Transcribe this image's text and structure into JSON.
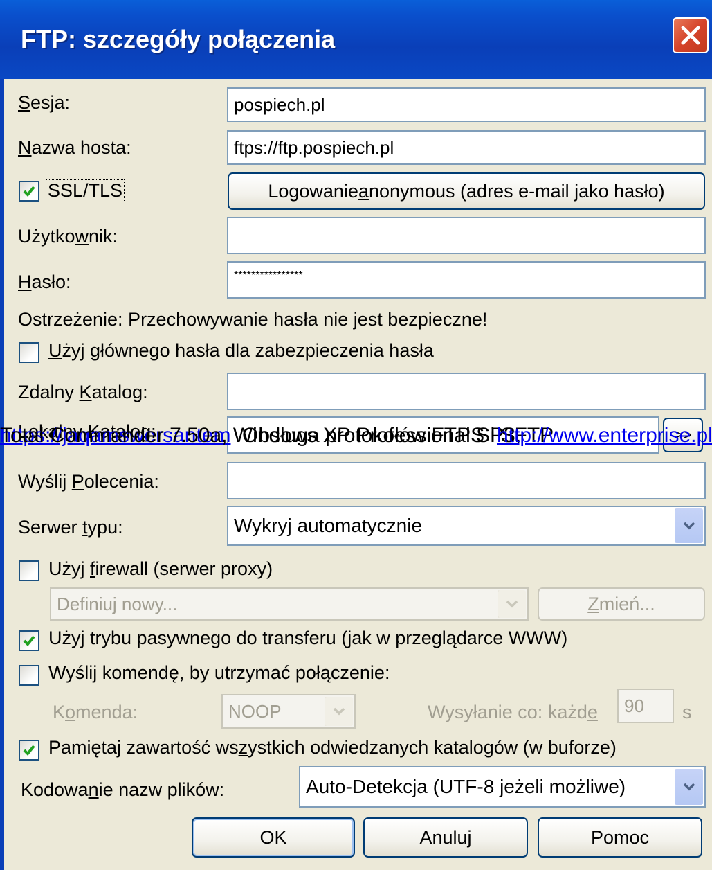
{
  "window": {
    "title": "FTP: szczegóły połączenia",
    "close_icon": "close-icon"
  },
  "form": {
    "session": {
      "label_u": "S",
      "label_rest": "esja:",
      "value": "pospiech.pl"
    },
    "host": {
      "label_u": "N",
      "label_rest": "azwa hosta:",
      "value": "ftps://ftp.pospiech.pl"
    },
    "ssl": {
      "label": "SSL/TLS",
      "checked": true
    },
    "anon_button": {
      "before": "Logowanie ",
      "u": "a",
      "after": "nonymous (adres e-mail jako hasło)"
    },
    "user": {
      "label_before": "Użytko",
      "label_u": "w",
      "label_after": "nik:",
      "value": ""
    },
    "password": {
      "label_u": "H",
      "label_rest": "asło:",
      "value": "****************"
    },
    "warning": "Ostrzeżenie: Przechowywanie hasła nie jest bezpieczne!",
    "master_pw": {
      "u": "U",
      "rest": "żyj głównego hasła dla zabezpieczenia hasła",
      "checked": false
    },
    "remote_dir": {
      "label_before": "Zdalny ",
      "label_u": "K",
      "label_after": "atalog:",
      "value": ""
    },
    "local_dir": {
      "label": "Lokalny Katalog:",
      "value": "",
      "browse": ">>"
    },
    "send_cmds": {
      "label_before": "Wyślij ",
      "label_u": "P",
      "label_after": "olecenia:",
      "value": ""
    },
    "server_type": {
      "label_before": "Serwer ",
      "label_u": "t",
      "label_after": "ypu:",
      "value": "Wykryj automatycznie"
    },
    "firewall": {
      "before": "Użyj ",
      "u": "f",
      "after": "irewall (serwer proxy)",
      "checked": false
    },
    "proxy": {
      "value": "Definiuj nowy...",
      "change_u": "Z",
      "change_rest": "mień..."
    },
    "passive": {
      "label": "Użyj trybu pasywnego do transferu (jak w przeglądarce WWW)",
      "checked": true
    },
    "keepalive": {
      "label": "Wyślij komendę, by utrzymać połączenie:",
      "checked": false
    },
    "command": {
      "label_before": "K",
      "label_u": "o",
      "label_after": "menda:",
      "value": "NOOP"
    },
    "interval": {
      "label_before": "Wysyłanie co: każd",
      "label_u": "e",
      "value": "90",
      "unit": "s"
    },
    "remember_dirs": {
      "label_before": "Pamiętaj zawartość ws",
      "label_u": "z",
      "label_after": "ystkich odwiedzanych katalogów (w buforze)",
      "checked": true
    },
    "encoding": {
      "label_before": "Kodowa",
      "label_u": "n",
      "label_after": "ie nazw plików:",
      "value": "Auto-Detekcja (UTF-8 jeżeli możliwe)"
    }
  },
  "buttons": {
    "ok": "OK",
    "cancel": "Anuluj",
    "help": "Pomoc"
  },
  "overlay": {
    "text1": "Total Commander 7.50a, Windows XP Professional SP3,",
    "link1": "https://jaqamswersantem",
    "text2": "Obsługa protokołów FTPS i SFTP",
    "link2": "http://www.enterprise.pl"
  },
  "colors": {
    "titlebar": "#0a4fcc",
    "dialog_bg": "#ece9d8",
    "check_green": "#21a121"
  }
}
